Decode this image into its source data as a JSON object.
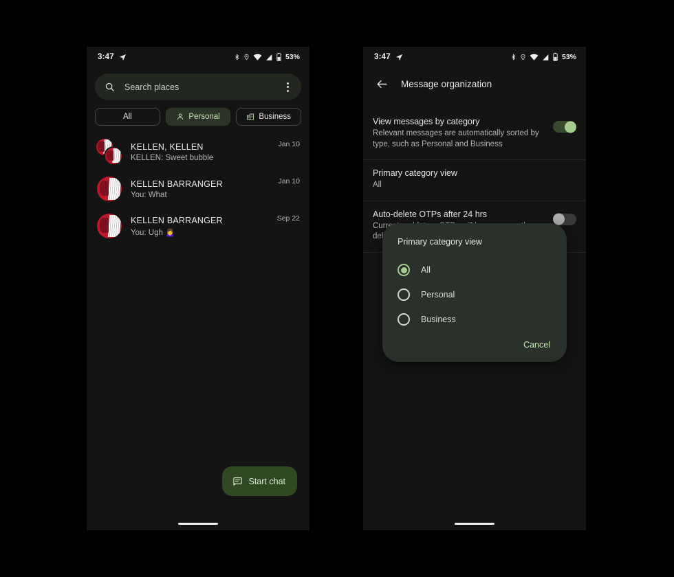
{
  "status_bar": {
    "time": "3:47",
    "battery_text": "53%",
    "icons": [
      "navigation-icon",
      "bluetooth-icon",
      "location-icon",
      "wifi-icon",
      "signal-icon",
      "battery-icon"
    ]
  },
  "colors": {
    "accent_green": "#a5cb8f",
    "chip_selected_bg": "#2b3427",
    "fab_bg": "#2f4a23",
    "dialog_bg": "#2a302a",
    "page_bg": "#141414",
    "cancel_text": "#c5e8b7"
  },
  "left_phone": {
    "search": {
      "placeholder": "Search places",
      "icon": "search-icon",
      "overflow_icon": "more-vert-icon"
    },
    "chips": [
      {
        "label": "All",
        "selected": false,
        "icon": null
      },
      {
        "label": "Personal",
        "selected": true,
        "icon": "person-icon"
      },
      {
        "label": "Business",
        "selected": false,
        "icon": "business-icon"
      }
    ],
    "conversations": [
      {
        "name": "KELLEN, KELLEN",
        "snippet": "KELLEN: Sweet bubble",
        "date": "Jan 10",
        "group": true
      },
      {
        "name": "KELLEN BARRANGER",
        "snippet": "You: What",
        "date": "Jan 10",
        "group": false
      },
      {
        "name": "KELLEN BARRANGER",
        "snippet": "You: Ugh 🙍‍♀️",
        "date": "Sep 22",
        "group": false
      }
    ],
    "fab": {
      "label": "Start chat",
      "icon": "chat-message-icon"
    }
  },
  "right_phone": {
    "app_bar": {
      "back_icon": "arrow-back-icon",
      "title": "Message organization"
    },
    "settings": [
      {
        "title": "View messages by category",
        "subtitle": "Relevant messages are automatically sorted by type, such as Personal and Business",
        "control": "switch",
        "state": "on"
      },
      {
        "title": "Primary category view",
        "subtitle": "All",
        "control": "none",
        "state": ""
      },
      {
        "title": "Auto-delete OTPs after 24 hrs",
        "subtitle": "Current and future OTPs will be permanently deleted",
        "control": "switch",
        "state": "off"
      }
    ],
    "dialog": {
      "title": "Primary category view",
      "options": [
        {
          "label": "All",
          "checked": true
        },
        {
          "label": "Personal",
          "checked": false
        },
        {
          "label": "Business",
          "checked": false
        }
      ],
      "cancel_label": "Cancel"
    }
  }
}
